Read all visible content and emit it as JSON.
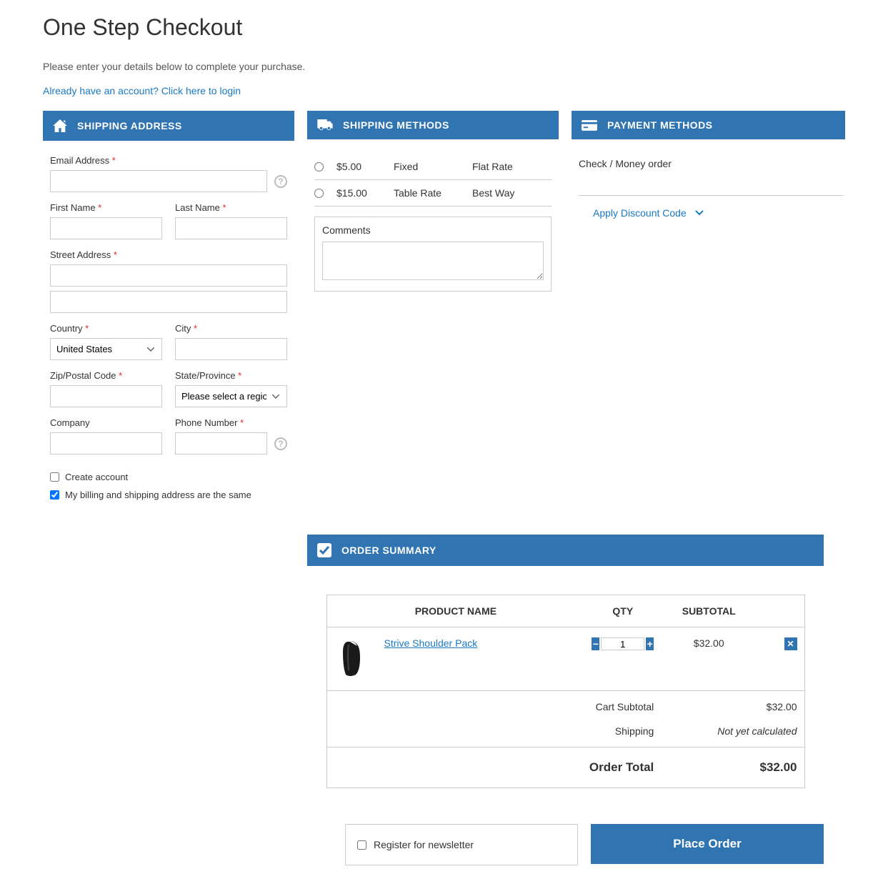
{
  "page": {
    "title": "One Step Checkout",
    "intro": "Please enter your details below to complete your purchase.",
    "login_link": "Already have an account? Click here to login"
  },
  "shipping_address": {
    "header": "SHIPPING ADDRESS",
    "email_label": "Email Address",
    "first_name_label": "First Name",
    "last_name_label": "Last Name",
    "street_label": "Street Address",
    "country_label": "Country",
    "country_value": "United States",
    "city_label": "City",
    "zip_label": "Zip/Postal Code",
    "state_label": "State/Province",
    "state_placeholder": "Please select a region",
    "company_label": "Company",
    "phone_label": "Phone Number",
    "create_account_label": "Create account",
    "billing_same_label": "My billing and shipping address are the same"
  },
  "shipping_methods": {
    "header": "SHIPPING METHODS",
    "options": [
      {
        "price": "$5.00",
        "name": "Fixed",
        "carrier": "Flat Rate"
      },
      {
        "price": "$15.00",
        "name": "Table Rate",
        "carrier": "Best Way"
      }
    ],
    "comments_label": "Comments"
  },
  "payment": {
    "header": "PAYMENT METHODS",
    "option": "Check / Money order",
    "discount_toggle": "Apply Discount Code"
  },
  "order_summary": {
    "header": "ORDER SUMMARY",
    "columns": {
      "product": "PRODUCT NAME",
      "qty": "QTY",
      "subtotal": "SUBTOTAL"
    },
    "item": {
      "name": "Strive Shoulder Pack",
      "qty": "1",
      "subtotal": "$32.00"
    },
    "totals": {
      "cart_subtotal_label": "Cart Subtotal",
      "cart_subtotal_value": "$32.00",
      "shipping_label": "Shipping",
      "shipping_value": "Not yet calculated",
      "order_total_label": "Order Total",
      "order_total_value": "$32.00"
    }
  },
  "newsletter": {
    "label": "Register for newsletter"
  },
  "place_order": {
    "label": "Place Order"
  }
}
